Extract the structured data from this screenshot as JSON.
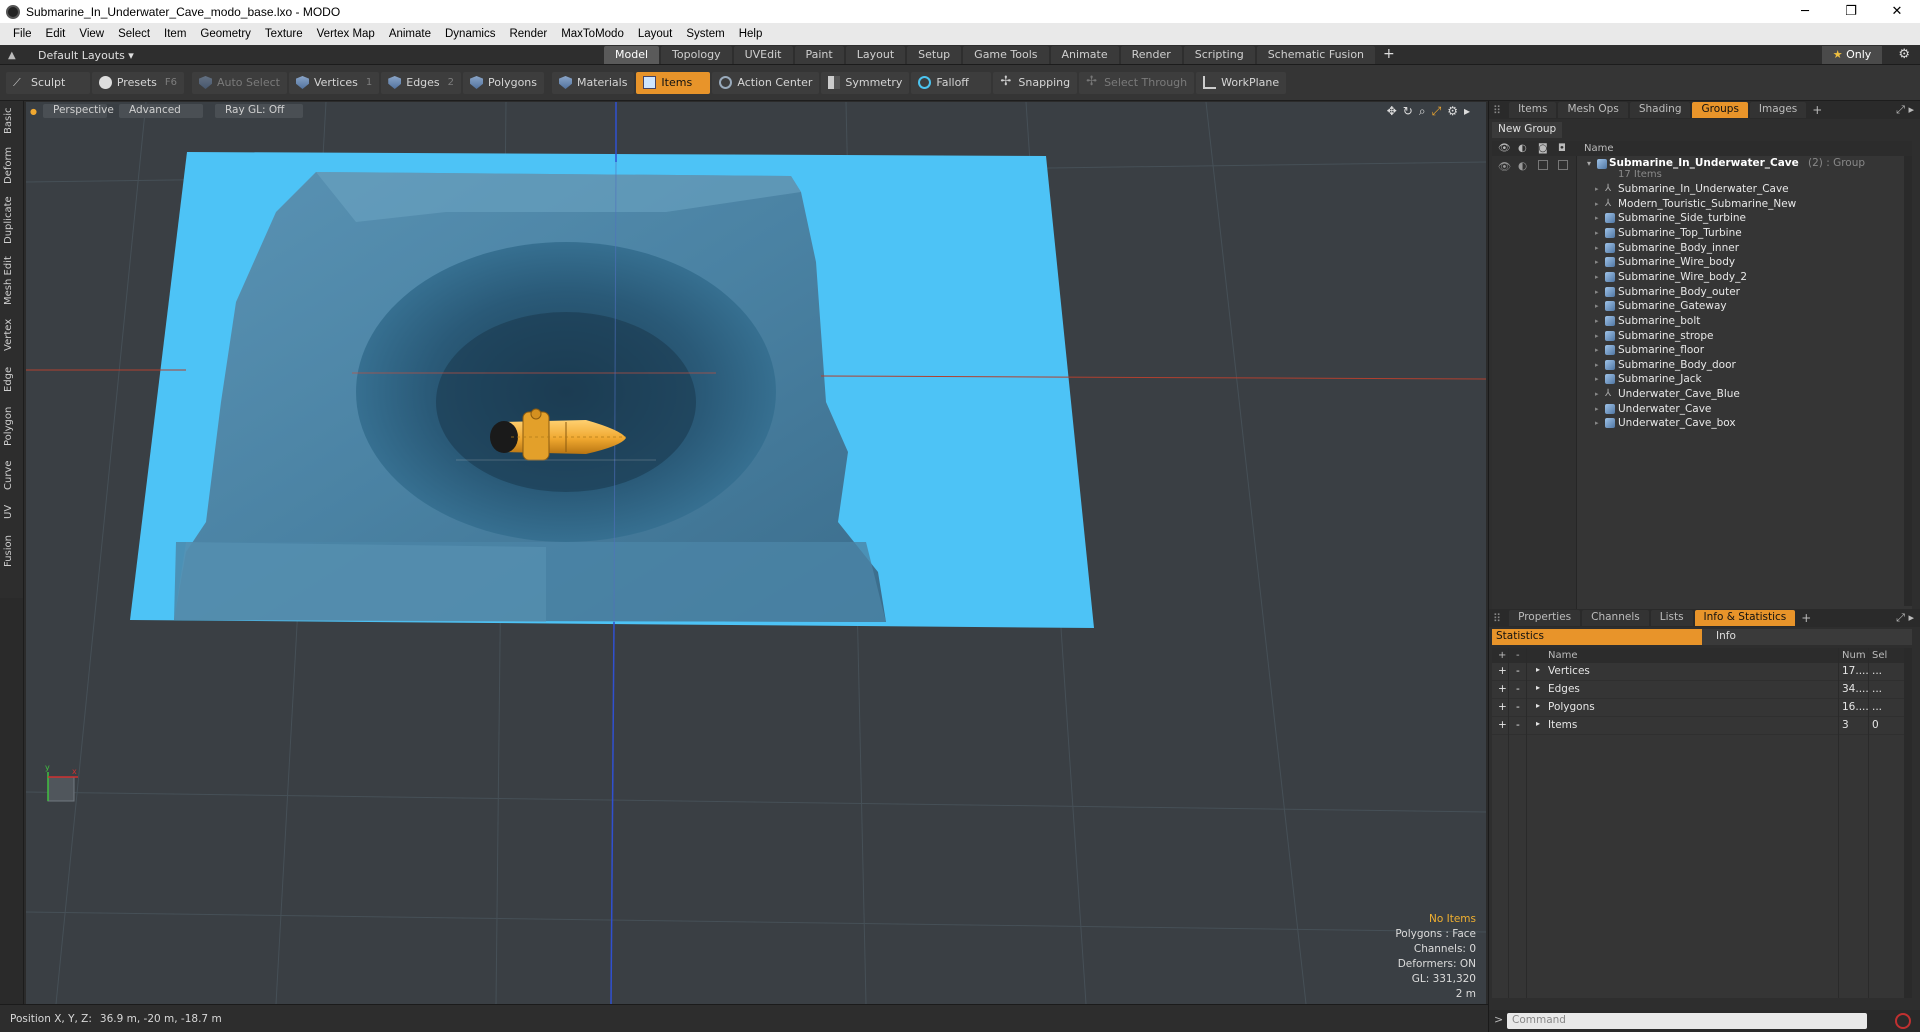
{
  "window": {
    "title": "Submarine_In_Underwater_Cave_modo_base.lxo - MODO",
    "controls": [
      "─",
      "❐",
      "✕"
    ]
  },
  "menu": [
    "File",
    "Edit",
    "View",
    "Select",
    "Item",
    "Geometry",
    "Texture",
    "Vertex Map",
    "Animate",
    "Dynamics",
    "Render",
    "MaxToModo",
    "Layout",
    "System",
    "Help"
  ],
  "layout_selector": "Default Layouts ▾",
  "layout_tabs": [
    "Model",
    "Topology",
    "UVEdit",
    "Paint",
    "Layout",
    "Setup",
    "Game Tools",
    "Animate",
    "Render",
    "Scripting",
    "Schematic Fusion"
  ],
  "active_layout_tab": "Model",
  "only_label": "Only",
  "toolbar": {
    "sculpt": "Sculpt",
    "presets": "Presets",
    "presets_key": "F6",
    "auto_select": "Auto Select",
    "vertices": "Vertices",
    "vertices_key": "1",
    "edges": "Edges",
    "edges_key": "2",
    "polygons": "Polygons",
    "materials": "Materials",
    "items": "Items",
    "action_center": "Action Center",
    "symmetry": "Symmetry",
    "falloff": "Falloff",
    "snapping": "Snapping",
    "select_through": "Select Through",
    "workplane": "WorkPlane"
  },
  "left_tabs": [
    "Basic",
    "Deform",
    "Duplicate",
    "Mesh Edit",
    "Vertex",
    "Edge",
    "Polygon",
    "Curve",
    "UV",
    "Fusion"
  ],
  "viewport": {
    "view_mode": "Perspective",
    "shading": "Advanced",
    "raygl": "Ray GL: Off",
    "stats": {
      "selection": "No Items",
      "polygons": "Polygons : Face",
      "channels": "Channels: 0",
      "deformers": "Deformers: ON",
      "gl": "GL: 331,320",
      "scale": "2 m"
    },
    "colors": {
      "water": "#4dc3f6",
      "cave": "#4a86a8",
      "bg": "#3a3f44",
      "submarine": "#f0a830"
    }
  },
  "status": {
    "label": "Position X, Y, Z:",
    "value": "36.9 m, -20 m, -18.7 m"
  },
  "top_panel": {
    "tabs": [
      "Items",
      "Mesh Ops",
      "Shading",
      "Groups",
      "Images"
    ],
    "active_tab": "Groups",
    "new_group": "New Group",
    "name_header": "Name",
    "group_name": "Submarine_In_Underwater_Cave",
    "group_suffix": "(2) : Group",
    "group_count": "17 Items",
    "items": [
      {
        "name": "Submarine_In_Underwater_Cave",
        "icon": "locator"
      },
      {
        "name": "Modern_Touristic_Submarine_New",
        "icon": "locator"
      },
      {
        "name": "Submarine_Side_turbine",
        "icon": "mesh"
      },
      {
        "name": "Submarine_Top_Turbine",
        "icon": "mesh"
      },
      {
        "name": "Submarine_Body_inner",
        "icon": "mesh"
      },
      {
        "name": "Submarine_Wire_body",
        "icon": "mesh"
      },
      {
        "name": "Submarine_Wire_body_2",
        "icon": "mesh"
      },
      {
        "name": "Submarine_Body_outer",
        "icon": "mesh"
      },
      {
        "name": "Submarine_Gateway",
        "icon": "mesh"
      },
      {
        "name": "Submarine_bolt",
        "icon": "mesh"
      },
      {
        "name": "Submarine_strope",
        "icon": "mesh"
      },
      {
        "name": "Submarine_floor",
        "icon": "mesh"
      },
      {
        "name": "Submarine_Body_door",
        "icon": "mesh"
      },
      {
        "name": "Submarine_Jack",
        "icon": "mesh"
      },
      {
        "name": "Underwater_Cave_Blue",
        "icon": "locator"
      },
      {
        "name": "Underwater_Cave",
        "icon": "mesh"
      },
      {
        "name": "Underwater_Cave_box",
        "icon": "mesh"
      }
    ]
  },
  "bottom_panel": {
    "tabs": [
      "Properties",
      "Channels",
      "Lists",
      "Info & Statistics"
    ],
    "active_tab": "Info & Statistics",
    "sub_tabs": [
      "Statistics",
      "Info"
    ],
    "headers": [
      "+",
      "-",
      "Name",
      "Num",
      "Sel"
    ],
    "rows": [
      {
        "name": "Vertices",
        "num": "17....",
        "sel": "..."
      },
      {
        "name": "Edges",
        "num": "34....",
        "sel": "..."
      },
      {
        "name": "Polygons",
        "num": "16....",
        "sel": "..."
      },
      {
        "name": "Items",
        "num": "3",
        "sel": "0"
      }
    ]
  },
  "command_placeholder": "Command"
}
